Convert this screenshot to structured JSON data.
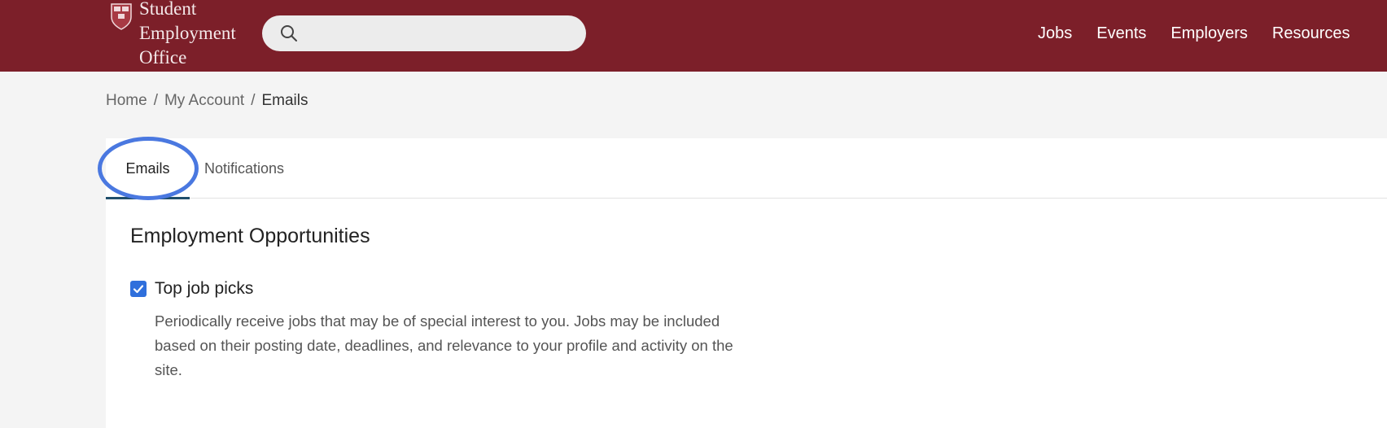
{
  "header": {
    "logo": {
      "line1": "Student",
      "line2": "Employment",
      "line3": "Office"
    },
    "search": {
      "placeholder": "",
      "value": ""
    },
    "nav": [
      "Jobs",
      "Events",
      "Employers",
      "Resources"
    ]
  },
  "breadcrumb": {
    "items": [
      "Home",
      "My Account",
      "Emails"
    ],
    "separator": "/"
  },
  "tabs": {
    "emails": "Emails",
    "notifications": "Notifications",
    "active": "Emails"
  },
  "section": {
    "title": "Employment Opportunities",
    "option": {
      "label": "Top job picks",
      "checked": true,
      "description": "Periodically receive jobs that may be of special interest to you. Jobs may be included based on their posting date, deadlines, and relevance to your profile and activity on the site."
    }
  },
  "colors": {
    "header_bg": "#7c1f29",
    "accent": "#2f6fdc",
    "highlight_ring": "#4a78e0",
    "tab_underline": "#1f4e6b"
  },
  "icons": [
    "shield-logo-icon",
    "search-icon",
    "checkmark-icon"
  ]
}
